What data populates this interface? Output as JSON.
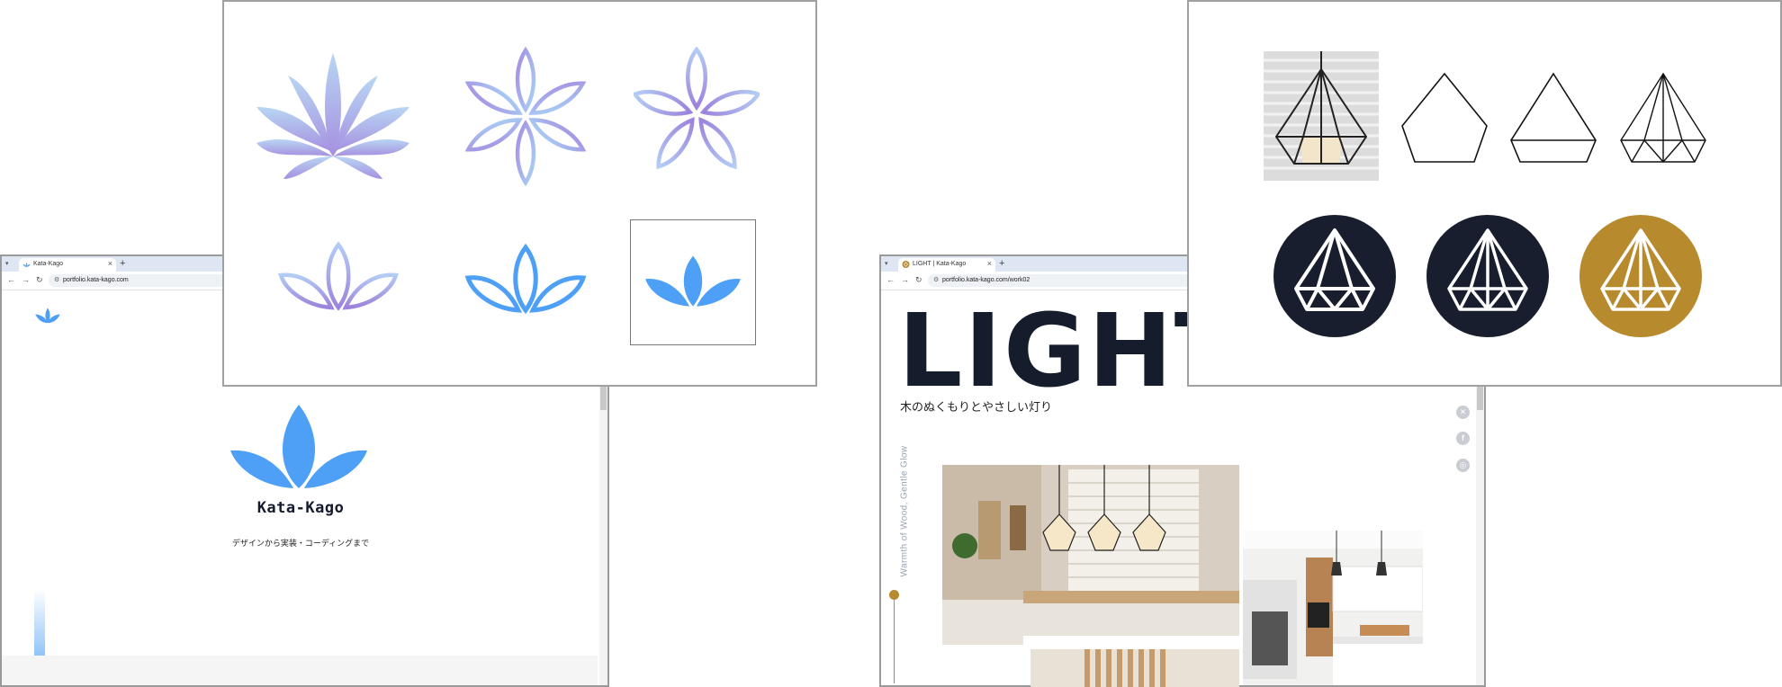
{
  "left_window": {
    "tab_title": "Kata-Kago",
    "url": "portfolio.kata-kago.com",
    "brand": "Kata-Kago",
    "tagline": "デザインから実装・コーディングまで"
  },
  "right_window": {
    "tab_title": "LIGHT | Kata-Kago",
    "url": "portfolio.kata-kago.com/work02",
    "hero_title": "LIGHT",
    "subtitle": "木のぬくもりとやさしい灯り",
    "vertical_caption": "Warmth of Wood, Gentle Glow",
    "social": [
      "x-icon",
      "facebook-icon",
      "instagram-icon"
    ]
  },
  "browser_chrome": {
    "new_tab": "+",
    "close": "×",
    "menu": "▾",
    "back": "←",
    "forward": "→",
    "reload": "↻"
  },
  "colors": {
    "navy": "#181e2e",
    "gold": "#b88a2e",
    "blue": "#4da0f5",
    "lavender": "#a99be6"
  }
}
